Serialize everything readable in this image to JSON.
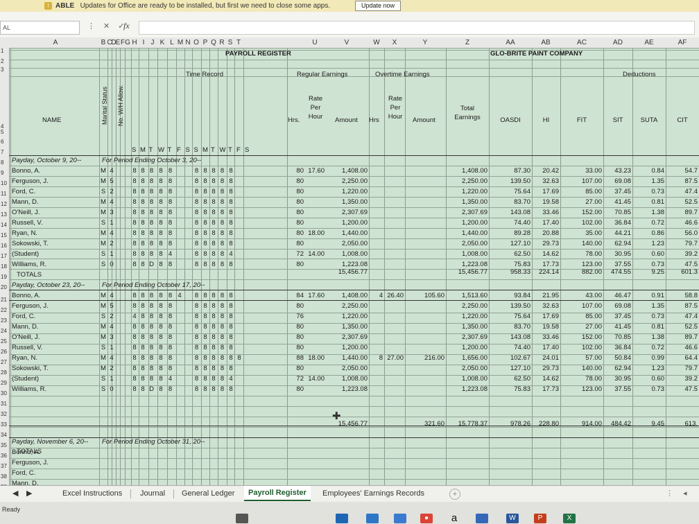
{
  "notification": {
    "title": "ABLE",
    "message": "Updates for Office are ready to be installed, but first we need to close some apps.",
    "button": "Update now"
  },
  "formula_bar": {
    "name_box": "AL",
    "fx": "fx"
  },
  "columns": [
    "A",
    "B",
    "C",
    "D",
    "E",
    "F",
    "G",
    "H",
    "I",
    "J",
    "K",
    "L",
    "M",
    "N",
    "O",
    "P",
    "Q",
    "R",
    "S",
    "T",
    "U",
    "V",
    "W",
    "X",
    "Y",
    "Z",
    "AA",
    "AB",
    "AC",
    "AD",
    "AE",
    "AF"
  ],
  "row_numbers": [
    "1",
    "2",
    "3",
    "4",
    "5",
    "6",
    "7",
    "8",
    "9",
    "10",
    "11",
    "12",
    "13",
    "14",
    "15",
    "16",
    "17",
    "18",
    "19",
    "20",
    "21",
    "22",
    "23",
    "24",
    "25",
    "26",
    "27",
    "28",
    "29",
    "30",
    "31",
    "32",
    "33",
    "34",
    "35",
    "36",
    "37",
    "38",
    "39"
  ],
  "header": {
    "title_left": "PAYROLL REGISTER",
    "title_right": "GLO-BRITE PAINT COMPANY",
    "time_record": "Time Record",
    "regular_earnings": "Regular Earnings",
    "overtime_earnings": "Overtime Earnings",
    "deductions": "Deductions",
    "marital_status": "Marital Status",
    "wh_allow": "No. W/H Allow.",
    "name": "NAME",
    "days": [
      "S",
      "M",
      "T",
      "W",
      "T",
      "F",
      "S",
      "S",
      "M",
      "T",
      "W",
      "T",
      "F",
      "S"
    ],
    "hrs": "Hrs.",
    "rate_per_hour": [
      "Rate",
      "Per",
      "Hour"
    ],
    "amount": "Amount",
    "ot_hrs": "Hrs",
    "total_earnings": [
      "Total",
      "Earnings"
    ],
    "ded_cols": [
      "OASDI",
      "HI",
      "FIT",
      "SIT",
      "SUTA",
      "CIT"
    ]
  },
  "sections": [
    {
      "payday": "Payday, October 9, 20--",
      "period": "For Period Ending October 3, 20--",
      "rows": [
        {
          "name": "Bonno, A.",
          "ms": "M",
          "wh": "4",
          "w1": [
            "8",
            "8",
            "8",
            "8",
            "8"
          ],
          "w2": [
            "8",
            "8",
            "8",
            "8",
            "8"
          ],
          "hrs": "80",
          "rate": "17.60",
          "amount": "1,408.00",
          "ot_hrs": "",
          "ot_rate": "",
          "ot_amount": "",
          "total": "1,408.00",
          "oasdi": "87.30",
          "hi": "20.42",
          "fit": "33.00",
          "sit": "43.23",
          "suta": "0.84",
          "cit": "54.7"
        },
        {
          "name": "Ferguson, J.",
          "ms": "M",
          "wh": "5",
          "w1": [
            "8",
            "8",
            "8",
            "8",
            "8"
          ],
          "w2": [
            "8",
            "8",
            "8",
            "8",
            "8"
          ],
          "hrs": "80",
          "rate": "",
          "amount": "2,250.00",
          "ot_hrs": "",
          "ot_rate": "",
          "ot_amount": "",
          "total": "2,250.00",
          "oasdi": "139.50",
          "hi": "32.63",
          "fit": "107.00",
          "sit": "69.08",
          "suta": "1.35",
          "cit": "87.5"
        },
        {
          "name": "Ford, C.",
          "ms": "S",
          "wh": "2",
          "w1": [
            "8",
            "8",
            "8",
            "8",
            "8"
          ],
          "w2": [
            "8",
            "8",
            "8",
            "8",
            "8"
          ],
          "hrs": "80",
          "rate": "",
          "amount": "1,220.00",
          "ot_hrs": "",
          "ot_rate": "",
          "ot_amount": "",
          "total": "1,220.00",
          "oasdi": "75.64",
          "hi": "17.69",
          "fit": "85.00",
          "sit": "37.45",
          "suta": "0.73",
          "cit": "47.4"
        },
        {
          "name": "Mann, D.",
          "ms": "M",
          "wh": "4",
          "w1": [
            "8",
            "8",
            "8",
            "8",
            "8"
          ],
          "w2": [
            "8",
            "8",
            "8",
            "8",
            "8"
          ],
          "hrs": "80",
          "rate": "",
          "amount": "1,350.00",
          "ot_hrs": "",
          "ot_rate": "",
          "ot_amount": "",
          "total": "1,350.00",
          "oasdi": "83.70",
          "hi": "19.58",
          "fit": "27.00",
          "sit": "41.45",
          "suta": "0.81",
          "cit": "52.5"
        },
        {
          "name": "O'Neill, J.",
          "ms": "M",
          "wh": "3",
          "w1": [
            "8",
            "8",
            "8",
            "8",
            "8"
          ],
          "w2": [
            "8",
            "8",
            "8",
            "8",
            "8"
          ],
          "hrs": "80",
          "rate": "",
          "amount": "2,307.69",
          "ot_hrs": "",
          "ot_rate": "",
          "ot_amount": "",
          "total": "2,307.69",
          "oasdi": "143.08",
          "hi": "33.46",
          "fit": "152.00",
          "sit": "70.85",
          "suta": "1.38",
          "cit": "89.7"
        },
        {
          "name": "Russell, V.",
          "ms": "S",
          "wh": "1",
          "w1": [
            "8",
            "8",
            "8",
            "8",
            "8"
          ],
          "w2": [
            "8",
            "8",
            "8",
            "8",
            "8"
          ],
          "hrs": "80",
          "rate": "",
          "amount": "1,200.00",
          "ot_hrs": "",
          "ot_rate": "",
          "ot_amount": "",
          "total": "1,200.00",
          "oasdi": "74.40",
          "hi": "17.40",
          "fit": "102.00",
          "sit": "36.84",
          "suta": "0.72",
          "cit": "46.6"
        },
        {
          "name": "Ryan, N.",
          "ms": "M",
          "wh": "4",
          "w1": [
            "8",
            "8",
            "8",
            "8",
            "8"
          ],
          "w2": [
            "8",
            "8",
            "8",
            "8",
            "8"
          ],
          "hrs": "80",
          "rate": "18.00",
          "amount": "1,440.00",
          "ot_hrs": "",
          "ot_rate": "",
          "ot_amount": "",
          "total": "1,440.00",
          "oasdi": "89.28",
          "hi": "20.88",
          "fit": "35.00",
          "sit": "44.21",
          "suta": "0.86",
          "cit": "56.0"
        },
        {
          "name": "Sokowski, T.",
          "ms": "M",
          "wh": "2",
          "w1": [
            "8",
            "8",
            "8",
            "8",
            "8"
          ],
          "w2": [
            "8",
            "8",
            "8",
            "8",
            "8"
          ],
          "hrs": "80",
          "rate": "",
          "amount": "2,050.00",
          "ot_hrs": "",
          "ot_rate": "",
          "ot_amount": "",
          "total": "2,050.00",
          "oasdi": "127.10",
          "hi": "29.73",
          "fit": "140.00",
          "sit": "62.94",
          "suta": "1.23",
          "cit": "79.7"
        },
        {
          "name": "(Student)",
          "ms": "S",
          "wh": "1",
          "w1": [
            "8",
            "8",
            "8",
            "8",
            "4"
          ],
          "w2": [
            "8",
            "8",
            "8",
            "8",
            "4"
          ],
          "hrs": "72",
          "rate": "14.00",
          "amount": "1,008.00",
          "ot_hrs": "",
          "ot_rate": "",
          "ot_amount": "",
          "total": "1,008.00",
          "oasdi": "62.50",
          "hi": "14.62",
          "fit": "78.00",
          "sit": "30.95",
          "suta": "0.60",
          "cit": "39.2"
        },
        {
          "name": "Williams, R.",
          "ms": "S",
          "wh": "0",
          "w1": [
            "8",
            "8",
            "D",
            "8",
            "8"
          ],
          "w2": [
            "8",
            "8",
            "8",
            "8",
            "8"
          ],
          "hrs": "80",
          "rate": "",
          "amount": "1,223.08",
          "ot_hrs": "",
          "ot_rate": "",
          "ot_amount": "",
          "total": "1,223.08",
          "oasdi": "75.83",
          "hi": "17.73",
          "fit": "123.00",
          "sit": "37.55",
          "suta": "0.73",
          "cit": "47.5"
        }
      ],
      "totals": {
        "label": "TOTALS",
        "amount": "15,456.77",
        "ot_amount": "",
        "total": "15,456.77",
        "oasdi": "958.33",
        "hi": "224.14",
        "fit": "882.00",
        "sit": "474.55",
        "suta": "9.25",
        "cit": "601.3"
      }
    },
    {
      "payday": "Payday, October 23, 20--",
      "period": "For Period Ending October 17, 20--",
      "rows": [
        {
          "name": "Bonno, A.",
          "ms": "M",
          "wh": "4",
          "w1": [
            "8",
            "8",
            "8",
            "8",
            "8",
            "4"
          ],
          "w2": [
            "8",
            "8",
            "8",
            "8",
            "8"
          ],
          "hrs": "84",
          "rate": "17.60",
          "amount": "1,408.00",
          "ot_hrs": "4",
          "ot_rate": "26.40",
          "ot_amount": "105.60",
          "total": "1,513.60",
          "oasdi": "93.84",
          "hi": "21.95",
          "fit": "43.00",
          "sit": "46.47",
          "suta": "0.91",
          "cit": "58.8"
        },
        {
          "name": "Ferguson, J.",
          "ms": "M",
          "wh": "5",
          "w1": [
            "8",
            "8",
            "8",
            "8",
            "8"
          ],
          "w2": [
            "8",
            "8",
            "8",
            "8",
            "8"
          ],
          "hrs": "80",
          "rate": "",
          "amount": "2,250.00",
          "ot_hrs": "",
          "ot_rate": "",
          "ot_amount": "",
          "total": "2,250.00",
          "oasdi": "139.50",
          "hi": "32.63",
          "fit": "107.00",
          "sit": "69.08",
          "suta": "1.35",
          "cit": "87.5"
        },
        {
          "name": "Ford, C.",
          "ms": "S",
          "wh": "2",
          "w1": [
            "4",
            "8",
            "8",
            "8",
            "8"
          ],
          "w2": [
            "8",
            "8",
            "8",
            "8",
            "8"
          ],
          "hrs": "76",
          "rate": "",
          "amount": "1,220.00",
          "ot_hrs": "",
          "ot_rate": "",
          "ot_amount": "",
          "total": "1,220.00",
          "oasdi": "75.64",
          "hi": "17.69",
          "fit": "85.00",
          "sit": "37.45",
          "suta": "0.73",
          "cit": "47.4"
        },
        {
          "name": "Mann, D.",
          "ms": "M",
          "wh": "4",
          "w1": [
            "8",
            "8",
            "8",
            "8",
            "8"
          ],
          "w2": [
            "8",
            "8",
            "8",
            "8",
            "8"
          ],
          "hrs": "80",
          "rate": "",
          "amount": "1,350.00",
          "ot_hrs": "",
          "ot_rate": "",
          "ot_amount": "",
          "total": "1,350.00",
          "oasdi": "83.70",
          "hi": "19.58",
          "fit": "27.00",
          "sit": "41.45",
          "suta": "0.81",
          "cit": "52.5"
        },
        {
          "name": "O'Neill, J.",
          "ms": "M",
          "wh": "3",
          "w1": [
            "8",
            "8",
            "8",
            "8",
            "8"
          ],
          "w2": [
            "8",
            "8",
            "8",
            "8",
            "8"
          ],
          "hrs": "80",
          "rate": "",
          "amount": "2,307.69",
          "ot_hrs": "",
          "ot_rate": "",
          "ot_amount": "",
          "total": "2,307.69",
          "oasdi": "143.08",
          "hi": "33.46",
          "fit": "152.00",
          "sit": "70.85",
          "suta": "1.38",
          "cit": "89.7"
        },
        {
          "name": "Russell, V.",
          "ms": "S",
          "wh": "1",
          "w1": [
            "8",
            "8",
            "8",
            "8",
            "8"
          ],
          "w2": [
            "8",
            "8",
            "8",
            "8",
            "8"
          ],
          "hrs": "80",
          "rate": "",
          "amount": "1,200.00",
          "ot_hrs": "",
          "ot_rate": "",
          "ot_amount": "",
          "total": "1,200.00",
          "oasdi": "74.40",
          "hi": "17.40",
          "fit": "102.00",
          "sit": "36.84",
          "suta": "0.72",
          "cit": "46.6"
        },
        {
          "name": "Ryan, N.",
          "ms": "M",
          "wh": "4",
          "w1": [
            "8",
            "8",
            "8",
            "8",
            "8"
          ],
          "w2": [
            "8",
            "8",
            "8",
            "8",
            "8",
            "8"
          ],
          "hrs": "88",
          "rate": "18.00",
          "amount": "1,440.00",
          "ot_hrs": "8",
          "ot_rate": "27.00",
          "ot_amount": "216.00",
          "total": "1,656.00",
          "oasdi": "102.67",
          "hi": "24.01",
          "fit": "57.00",
          "sit": "50.84",
          "suta": "0.99",
          "cit": "64.4"
        },
        {
          "name": "Sokowski, T.",
          "ms": "M",
          "wh": "2",
          "w1": [
            "8",
            "8",
            "8",
            "8",
            "8"
          ],
          "w2": [
            "8",
            "8",
            "8",
            "8",
            "8"
          ],
          "hrs": "80",
          "rate": "",
          "amount": "2,050.00",
          "ot_hrs": "",
          "ot_rate": "",
          "ot_amount": "",
          "total": "2,050.00",
          "oasdi": "127.10",
          "hi": "29.73",
          "fit": "140.00",
          "sit": "62.94",
          "suta": "1.23",
          "cit": "79.7"
        },
        {
          "name": "(Student)",
          "ms": "S",
          "wh": "1",
          "w1": [
            "8",
            "8",
            "8",
            "8",
            "4"
          ],
          "w2": [
            "8",
            "8",
            "8",
            "8",
            "4"
          ],
          "hrs": "72",
          "rate": "14.00",
          "amount": "1,008.00",
          "ot_hrs": "",
          "ot_rate": "",
          "ot_amount": "",
          "total": "1,008.00",
          "oasdi": "62.50",
          "hi": "14.62",
          "fit": "78.00",
          "sit": "30.95",
          "suta": "0.60",
          "cit": "39.2"
        },
        {
          "name": "Williams, R.",
          "ms": "S",
          "wh": "0",
          "w1": [
            "8",
            "8",
            "D",
            "8",
            "8"
          ],
          "w2": [
            "8",
            "8",
            "8",
            "8",
            "8"
          ],
          "hrs": "80",
          "rate": "",
          "amount": "1,223.08",
          "ot_hrs": "",
          "ot_rate": "",
          "ot_amount": "",
          "total": "1,223.08",
          "oasdi": "75.83",
          "hi": "17.73",
          "fit": "123.00",
          "sit": "37.55",
          "suta": "0.73",
          "cit": "47.5"
        }
      ],
      "totals": {
        "label": "TOTALS",
        "amount": "15,456.77",
        "ot_amount": "321.60",
        "total": "15,778.37",
        "oasdi": "978.26",
        "hi": "228.80",
        "fit": "914.00",
        "sit": "484.42",
        "suta": "9.45",
        "cit": "613."
      }
    },
    {
      "payday": "Payday, November 6, 20--",
      "period": "For Period Ending October 31, 20--",
      "names": [
        "Bonno, A.",
        "Ferguson, J.",
        "Ford, C.",
        "Mann, D."
      ]
    }
  ],
  "sheet_tabs": [
    "Excel Instructions",
    "Journal",
    "General Ledger",
    "Payroll Register",
    "Employees' Earnings Records"
  ],
  "active_tab": "Payroll Register",
  "status": {
    "text": "Ready"
  },
  "taskbar": {
    "icons": [
      "a",
      "W",
      "P",
      "X"
    ]
  }
}
